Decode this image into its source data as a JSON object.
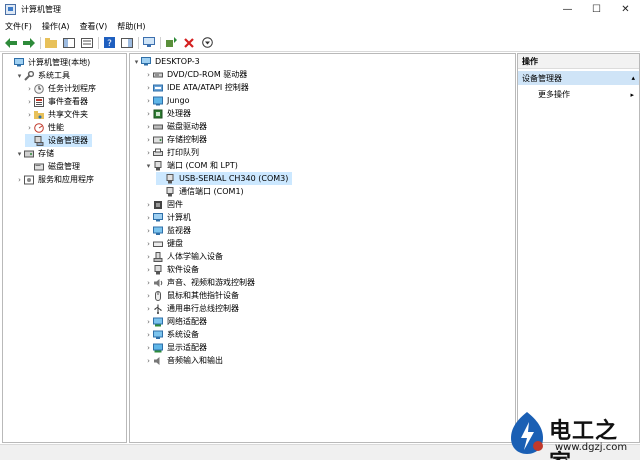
{
  "window": {
    "title": "计算机管理",
    "min": "—",
    "max": "☐",
    "close": "✕"
  },
  "menu": [
    "文件(F)",
    "操作(A)",
    "查看(V)",
    "帮助(H)"
  ],
  "left_tree": [
    {
      "label": "计算机管理(本地)",
      "expander": "",
      "icon": "computer-icon"
    },
    {
      "label": "系统工具",
      "expander": "▾",
      "icon": "tools-icon"
    },
    {
      "label": "任务计划程序",
      "expander": "›",
      "icon": "clock-icon"
    },
    {
      "label": "事件查看器",
      "expander": "›",
      "icon": "event-viewer-icon"
    },
    {
      "label": "共享文件夹",
      "expander": "›",
      "icon": "shared-folder-icon"
    },
    {
      "label": "性能",
      "expander": "›",
      "icon": "performance-icon"
    },
    {
      "label": "设备管理器",
      "expander": "",
      "icon": "device-manager-icon",
      "selected": true
    },
    {
      "label": "存储",
      "expander": "▾",
      "icon": "storage-icon"
    },
    {
      "label": "磁盘管理",
      "expander": "",
      "icon": "disk-icon"
    },
    {
      "label": "服务和应用程序",
      "expander": "›",
      "icon": "services-icon"
    }
  ],
  "device_tree": [
    {
      "label": "DESKTOP-3",
      "expander": "▾",
      "icon": "computer-icon"
    },
    {
      "label": "DVD/CD-ROM 驱动器",
      "expander": "›",
      "icon": "dvd-icon"
    },
    {
      "label": "IDE ATA/ATAPI 控制器",
      "expander": "›",
      "icon": "ide-icon"
    },
    {
      "label": "Jungo",
      "expander": "›",
      "icon": "jungo-icon"
    },
    {
      "label": "处理器",
      "expander": "›",
      "icon": "cpu-icon"
    },
    {
      "label": "磁盘驱动器",
      "expander": "›",
      "icon": "disk-drive-icon"
    },
    {
      "label": "存储控制器",
      "expander": "›",
      "icon": "storage-controller-icon"
    },
    {
      "label": "打印队列",
      "expander": "›",
      "icon": "printer-icon"
    },
    {
      "label": "端口 (COM 和 LPT)",
      "expander": "▾",
      "icon": "port-icon"
    },
    {
      "label": "USB-SERIAL CH340 (COM3)",
      "expander": "",
      "icon": "port-icon",
      "selected": true
    },
    {
      "label": "通信端口 (COM1)",
      "expander": "",
      "icon": "port-icon"
    },
    {
      "label": "固件",
      "expander": "›",
      "icon": "firmware-icon"
    },
    {
      "label": "计算机",
      "expander": "›",
      "icon": "computer-icon"
    },
    {
      "label": "监视器",
      "expander": "›",
      "icon": "monitor-icon"
    },
    {
      "label": "键盘",
      "expander": "›",
      "icon": "keyboard-icon"
    },
    {
      "label": "人体学输入设备",
      "expander": "›",
      "icon": "hid-icon"
    },
    {
      "label": "软件设备",
      "expander": "›",
      "icon": "software-device-icon"
    },
    {
      "label": "声音、视频和游戏控制器",
      "expander": "›",
      "icon": "speaker-icon"
    },
    {
      "label": "鼠标和其他指针设备",
      "expander": "›",
      "icon": "mouse-icon"
    },
    {
      "label": "通用串行总线控制器",
      "expander": "›",
      "icon": "usb-icon"
    },
    {
      "label": "网络适配器",
      "expander": "›",
      "icon": "network-icon"
    },
    {
      "label": "系统设备",
      "expander": "›",
      "icon": "system-device-icon"
    },
    {
      "label": "显示适配器",
      "expander": "›",
      "icon": "display-adapter-icon"
    },
    {
      "label": "音频输入和输出",
      "expander": "›",
      "icon": "audio-icon"
    }
  ],
  "actions": {
    "header": "操作",
    "section": "设备管理器",
    "section_caret": "▴",
    "more": "更多操作",
    "more_caret": "▸"
  },
  "watermark": {
    "brand": "电工之家",
    "url": "www.dgzj.com"
  },
  "colors": {
    "selection": "#cce8ff",
    "action_section": "#cfe4f7",
    "brand_blue": "#1a5fb4",
    "brand_red": "#c0392b"
  }
}
